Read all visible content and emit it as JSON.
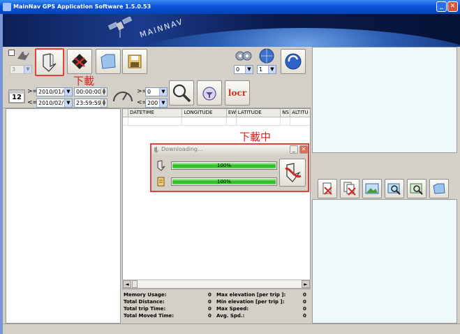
{
  "window": {
    "title": "MainNav GPS Application Software 1.5.0.53"
  },
  "banner": {
    "logo_text": "MAINNAV"
  },
  "toolbar": {
    "device_select": "3",
    "select_a": "0",
    "select_b": "1",
    "download_annotation": "下載"
  },
  "filter": {
    "date_from_op": ">=",
    "date_from": "2010/01/01",
    "time_from": "00:00:00",
    "date_to_op": "<=",
    "date_to": "2010/02/11",
    "time_to": "23:59:59",
    "speed_min_op": ">=",
    "speed_min": "0",
    "speed_max_op": "<=",
    "speed_max": "200",
    "calendar_day": "12",
    "locr_label": "locr"
  },
  "grid": {
    "columns": [
      "DATETIME",
      "LONGITUDE",
      "EW",
      "LATITUDE",
      "NS",
      "ALTITU"
    ]
  },
  "dialog": {
    "title": "Downloading...",
    "annotation": "下載中",
    "bar1_text": "100%",
    "bar1_value": 100,
    "bar2_text": "100%",
    "bar2_value": 100
  },
  "stats": {
    "memory_usage_label": "Memory Usage:",
    "memory_usage": "0",
    "total_distance_label": "Total Distance:",
    "total_distance": "0",
    "total_trip_time_label": "Total trip Time:",
    "total_trip_time": "0",
    "total_moved_time_label": "Total Moved Time:",
    "total_moved_time": "0",
    "max_elevation_label": "Max elevation [per trip ]:",
    "max_elevation": "0",
    "min_elevation_label": "Min elevation [per trip ]:",
    "min_elevation": "0",
    "max_speed_label": "Max Speed:",
    "max_speed": "0",
    "avg_spd_label": "Avg. Spd.:",
    "avg_spd": "0"
  },
  "colors": {
    "title_bar": "#0a52d8",
    "annotation_red": "#d9201b",
    "progress_green": "#26b81e",
    "panel_cyan": "#eefafa"
  }
}
